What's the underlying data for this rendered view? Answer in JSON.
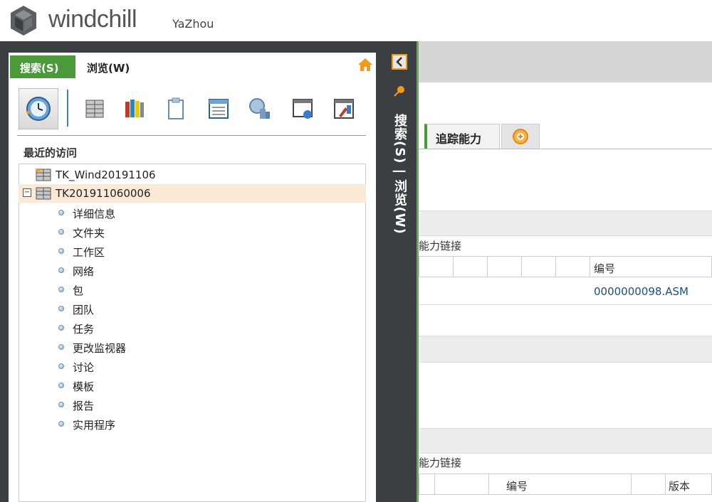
{
  "header": {
    "brand": "windchill",
    "user": "YaZhou"
  },
  "navigator": {
    "tabs": [
      {
        "label": "搜索(S)",
        "active": false
      },
      {
        "label": "浏览(W)",
        "active": true
      }
    ],
    "toolbar_icons": [
      "recent-visit-icon",
      "product-context-icon",
      "library-icon",
      "clipboard-icon",
      "table-icon",
      "organization-icon",
      "site-icon",
      "utilities-icon"
    ],
    "section_label": "最近的访问",
    "tree": {
      "items": [
        {
          "label": "TK_Wind20191106",
          "expanded": false
        },
        {
          "label": "TK201911060006",
          "expanded": true,
          "selected": true
        }
      ],
      "children": [
        "详细信息",
        "文件夹",
        "工作区",
        "网络",
        "包",
        "团队",
        "任务",
        "更改监视器",
        "讨论",
        "模板",
        "报告",
        "实用程序"
      ]
    },
    "vertical_label": "搜索(S) | 浏览(W)"
  },
  "content": {
    "tab": "追踪能力",
    "section1_title": "能力链接",
    "section1_columns": [
      "编号"
    ],
    "section1_row": {
      "number": "0000000098.ASM"
    },
    "section2_title": "能力链接",
    "section2_columns": [
      "编号",
      "版本"
    ]
  },
  "colors": {
    "accent_green": "#4a9a3a",
    "dark_frame": "#3b3f42",
    "orange": "#f39a1c",
    "selected_row": "#fce9d6",
    "link_blue": "#1f4e79"
  }
}
